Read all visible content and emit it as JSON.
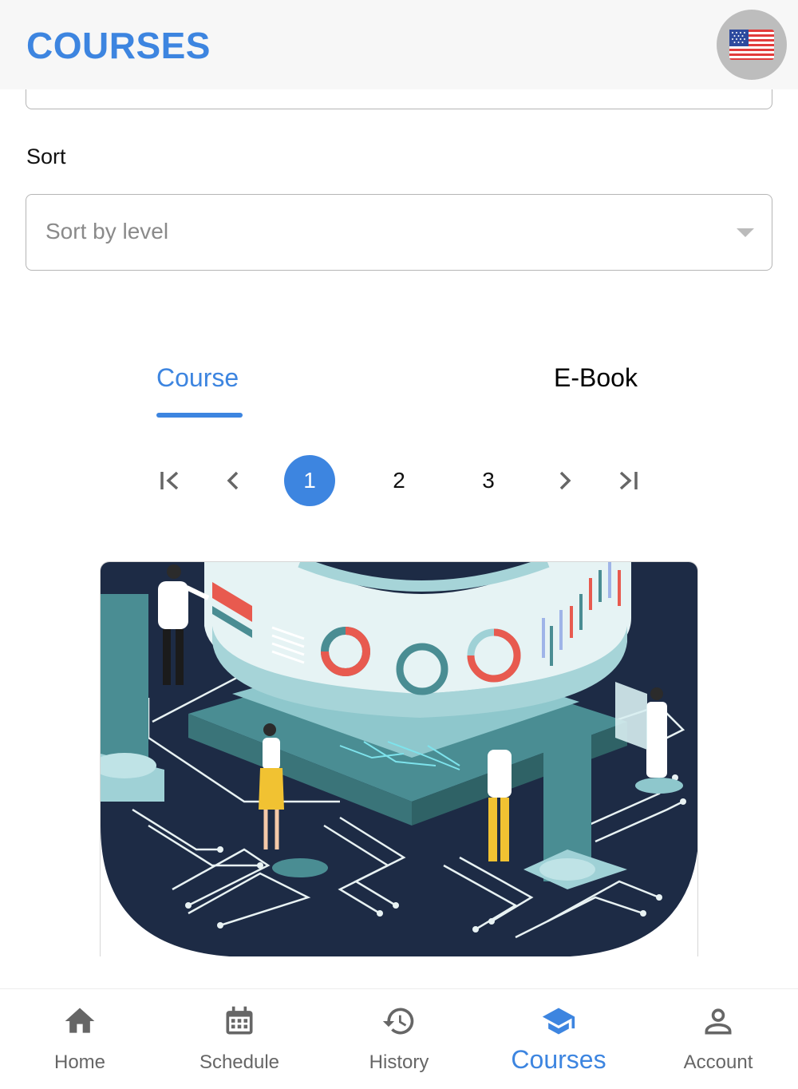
{
  "header": {
    "title": "COURSES",
    "language": "English (US)"
  },
  "filters": {
    "sort_label": "Sort",
    "sort_placeholder": "Sort by level"
  },
  "tabs": [
    {
      "label": "Course",
      "active": true
    },
    {
      "label": "E-Book",
      "active": false
    }
  ],
  "pagination": {
    "pages": [
      "1",
      "2",
      "3"
    ],
    "current": "1"
  },
  "bottom_nav": [
    {
      "label": "Home",
      "icon": "home-icon"
    },
    {
      "label": "Schedule",
      "icon": "calendar-icon"
    },
    {
      "label": "History",
      "icon": "history-icon"
    },
    {
      "label": "Courses",
      "icon": "graduation-cap-icon",
      "active": true
    },
    {
      "label": "Account",
      "icon": "person-icon"
    }
  ],
  "colors": {
    "accent": "#3d85e0",
    "header_bg": "#f7f7f7",
    "illustration_navy": "#1d2b45",
    "illustration_teal": "#4a8d93"
  }
}
